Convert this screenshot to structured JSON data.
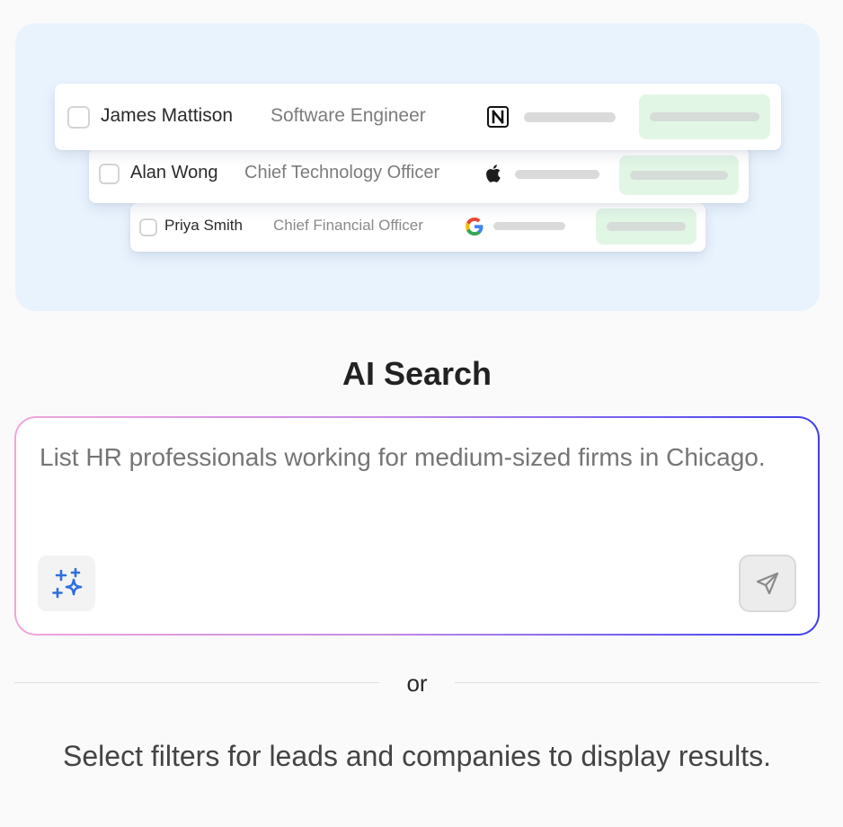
{
  "illustration": {
    "leads": [
      {
        "name": "James Mattison",
        "title": "Software Engineer",
        "company_icon": "notion-icon"
      },
      {
        "name": "Alan Wong",
        "title": "Chief Technology Officer",
        "company_icon": "apple-icon"
      },
      {
        "name": "Priya Smith",
        "title": "Chief Financial Officer",
        "company_icon": "google-icon"
      }
    ]
  },
  "ai_search": {
    "title": "AI Search",
    "placeholder": "List HR professionals working for medium-sized firms in Chicago.",
    "sparkle_icon": "sparkle-icon",
    "send_icon": "send-icon"
  },
  "divider": {
    "label": "or"
  },
  "hint": "Select filters for leads and companies to display results.",
  "colors": {
    "hero_bg": "#e9f3fe",
    "gradient_start": "#f0a6dc",
    "gradient_end": "#3d3fe8",
    "sparkle": "#2f6fe0",
    "chip_bg": "#e2f6e6"
  }
}
